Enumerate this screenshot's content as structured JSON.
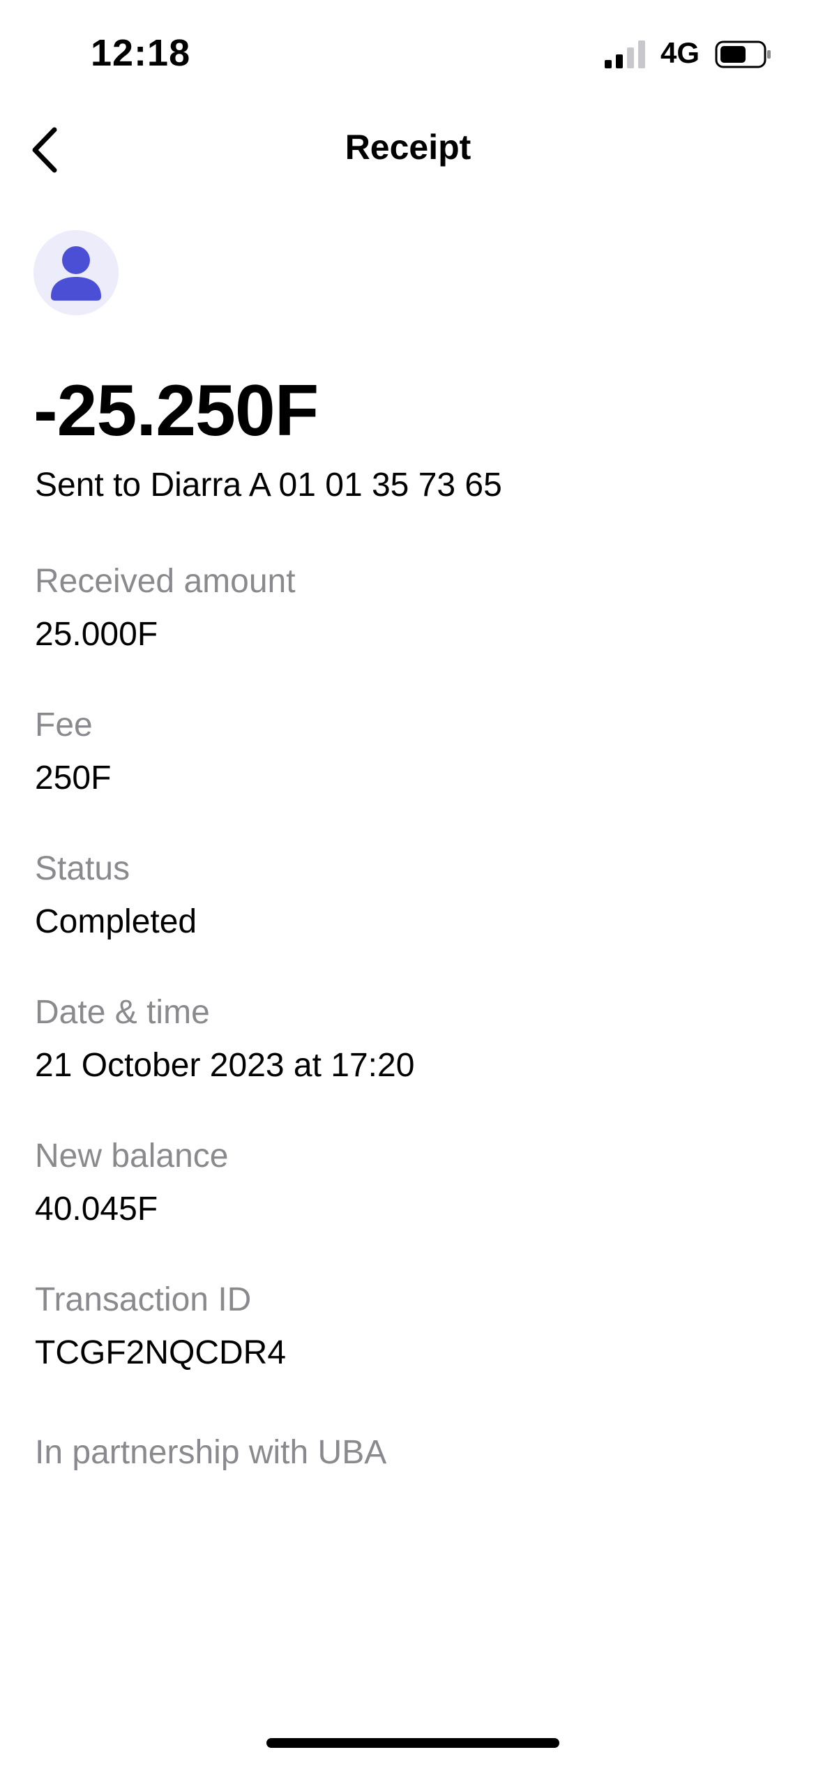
{
  "status_bar": {
    "time": "12:18",
    "network": "4G",
    "icons": [
      "signal-icon",
      "battery-icon"
    ]
  },
  "nav": {
    "title": "Receipt",
    "back_icon": "chevron-left-icon"
  },
  "receipt": {
    "avatar_icon": "person-icon",
    "amount": "-25.250F",
    "sent_to": "Sent to Diarra A 01 01 35 73 65",
    "details": [
      {
        "label": "Received amount",
        "value": "25.000F"
      },
      {
        "label": "Fee",
        "value": "250F"
      },
      {
        "label": "Status",
        "value": "Completed"
      },
      {
        "label": "Date & time",
        "value": "21 October 2023 at 17:20"
      },
      {
        "label": "New balance",
        "value": "40.045F"
      },
      {
        "label": "Transaction ID",
        "value": "TCGF2NQCDR4"
      }
    ],
    "partnership": "In partnership with UBA"
  },
  "colors": {
    "accent": "#4b4fd6",
    "avatar_bg": "#ececfa",
    "label_gray": "#8a8a8e"
  }
}
